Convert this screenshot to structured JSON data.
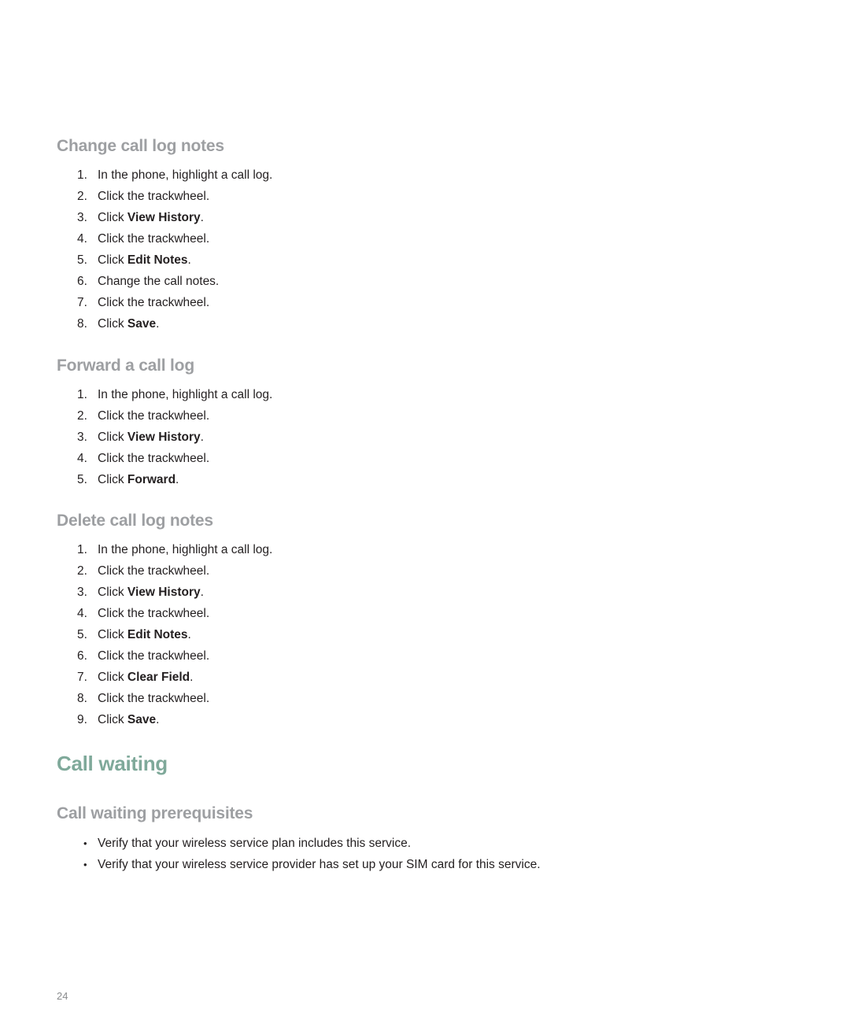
{
  "sections": [
    {
      "title": "Change call log notes",
      "steps": [
        {
          "num": "1.",
          "pre": "In the phone, highlight a call log.",
          "bold": "",
          "post": ""
        },
        {
          "num": "2.",
          "pre": "Click the trackwheel.",
          "bold": "",
          "post": ""
        },
        {
          "num": "3.",
          "pre": "Click ",
          "bold": "View History",
          "post": "."
        },
        {
          "num": "4.",
          "pre": "Click the trackwheel.",
          "bold": "",
          "post": ""
        },
        {
          "num": "5.",
          "pre": "Click ",
          "bold": "Edit Notes",
          "post": "."
        },
        {
          "num": "6.",
          "pre": "Change the call notes.",
          "bold": "",
          "post": ""
        },
        {
          "num": "7.",
          "pre": "Click the trackwheel.",
          "bold": "",
          "post": ""
        },
        {
          "num": "8.",
          "pre": "Click ",
          "bold": "Save",
          "post": "."
        }
      ]
    },
    {
      "title": "Forward a call log",
      "steps": [
        {
          "num": "1.",
          "pre": "In the phone, highlight a call log.",
          "bold": "",
          "post": ""
        },
        {
          "num": "2.",
          "pre": "Click the trackwheel.",
          "bold": "",
          "post": ""
        },
        {
          "num": "3.",
          "pre": "Click ",
          "bold": "View History",
          "post": "."
        },
        {
          "num": "4.",
          "pre": "Click the trackwheel.",
          "bold": "",
          "post": ""
        },
        {
          "num": "5.",
          "pre": "Click ",
          "bold": "Forward",
          "post": "."
        }
      ]
    },
    {
      "title": "Delete call log notes",
      "steps": [
        {
          "num": "1.",
          "pre": "In the phone, highlight a call log.",
          "bold": "",
          "post": ""
        },
        {
          "num": "2.",
          "pre": "Click the trackwheel.",
          "bold": "",
          "post": ""
        },
        {
          "num": "3.",
          "pre": "Click ",
          "bold": "View History",
          "post": "."
        },
        {
          "num": "4.",
          "pre": "Click the trackwheel.",
          "bold": "",
          "post": ""
        },
        {
          "num": "5.",
          "pre": "Click ",
          "bold": "Edit Notes",
          "post": "."
        },
        {
          "num": "6.",
          "pre": "Click the trackwheel.",
          "bold": "",
          "post": ""
        },
        {
          "num": "7.",
          "pre": "Click ",
          "bold": "Clear Field",
          "post": "."
        },
        {
          "num": "8.",
          "pre": "Click the trackwheel.",
          "bold": "",
          "post": ""
        },
        {
          "num": "9.",
          "pre": "Click ",
          "bold": "Save",
          "post": "."
        }
      ]
    }
  ],
  "chapter": {
    "title": "Call waiting",
    "color": "#7fa99a"
  },
  "prerequisites": {
    "title": "Call waiting prerequisites",
    "bullet_glyph": "•",
    "items": [
      "Verify that your wireless service plan includes this service.",
      "Verify that your wireless service provider has set up your SIM card for this service."
    ]
  },
  "page_number": "24",
  "colors": {
    "heading_gray": "#9d9fa2",
    "body_text": "#231f20"
  }
}
